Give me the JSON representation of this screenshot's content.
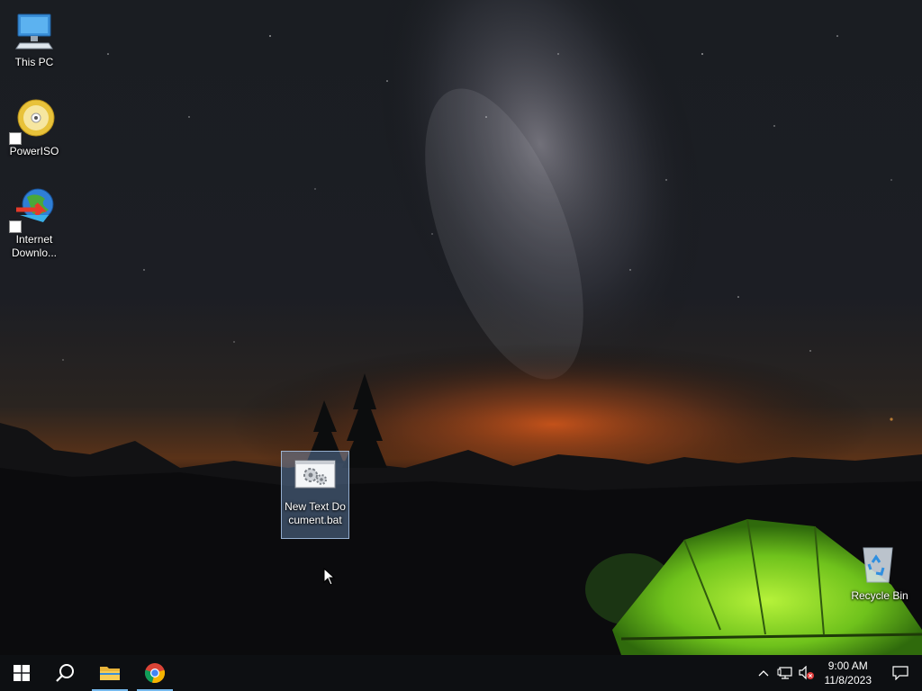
{
  "desktop": {
    "icons": [
      {
        "label": "This PC",
        "icon": "computer-icon"
      },
      {
        "label": "PowerISO",
        "icon": "poweriso-disc-icon"
      },
      {
        "label": "Internet Downlo...",
        "icon": "internet-download-manager-icon"
      },
      {
        "label": "New Text Document.bat",
        "icon": "batch-file-icon",
        "selected": true
      },
      {
        "label": "Recycle Bin",
        "icon": "recycle-bin-icon"
      }
    ]
  },
  "taskbar": {
    "pinned": [
      {
        "name": "Start",
        "icon": "windows-logo-icon"
      },
      {
        "name": "Search",
        "icon": "search-icon"
      },
      {
        "name": "File Explorer",
        "icon": "folder-icon",
        "running": true
      },
      {
        "name": "Google Chrome",
        "icon": "chrome-icon",
        "running": true
      }
    ],
    "tray": {
      "time": "9:00 AM",
      "date": "11/8/2023",
      "icons": [
        "chevron-up-icon",
        "network-icon",
        "volume-muted-icon",
        "notification-icon"
      ]
    }
  },
  "colors": {
    "taskbar_bg": "#0d0f12",
    "accent_running": "#76b9ed",
    "selection_bg": "#6f94c0"
  }
}
